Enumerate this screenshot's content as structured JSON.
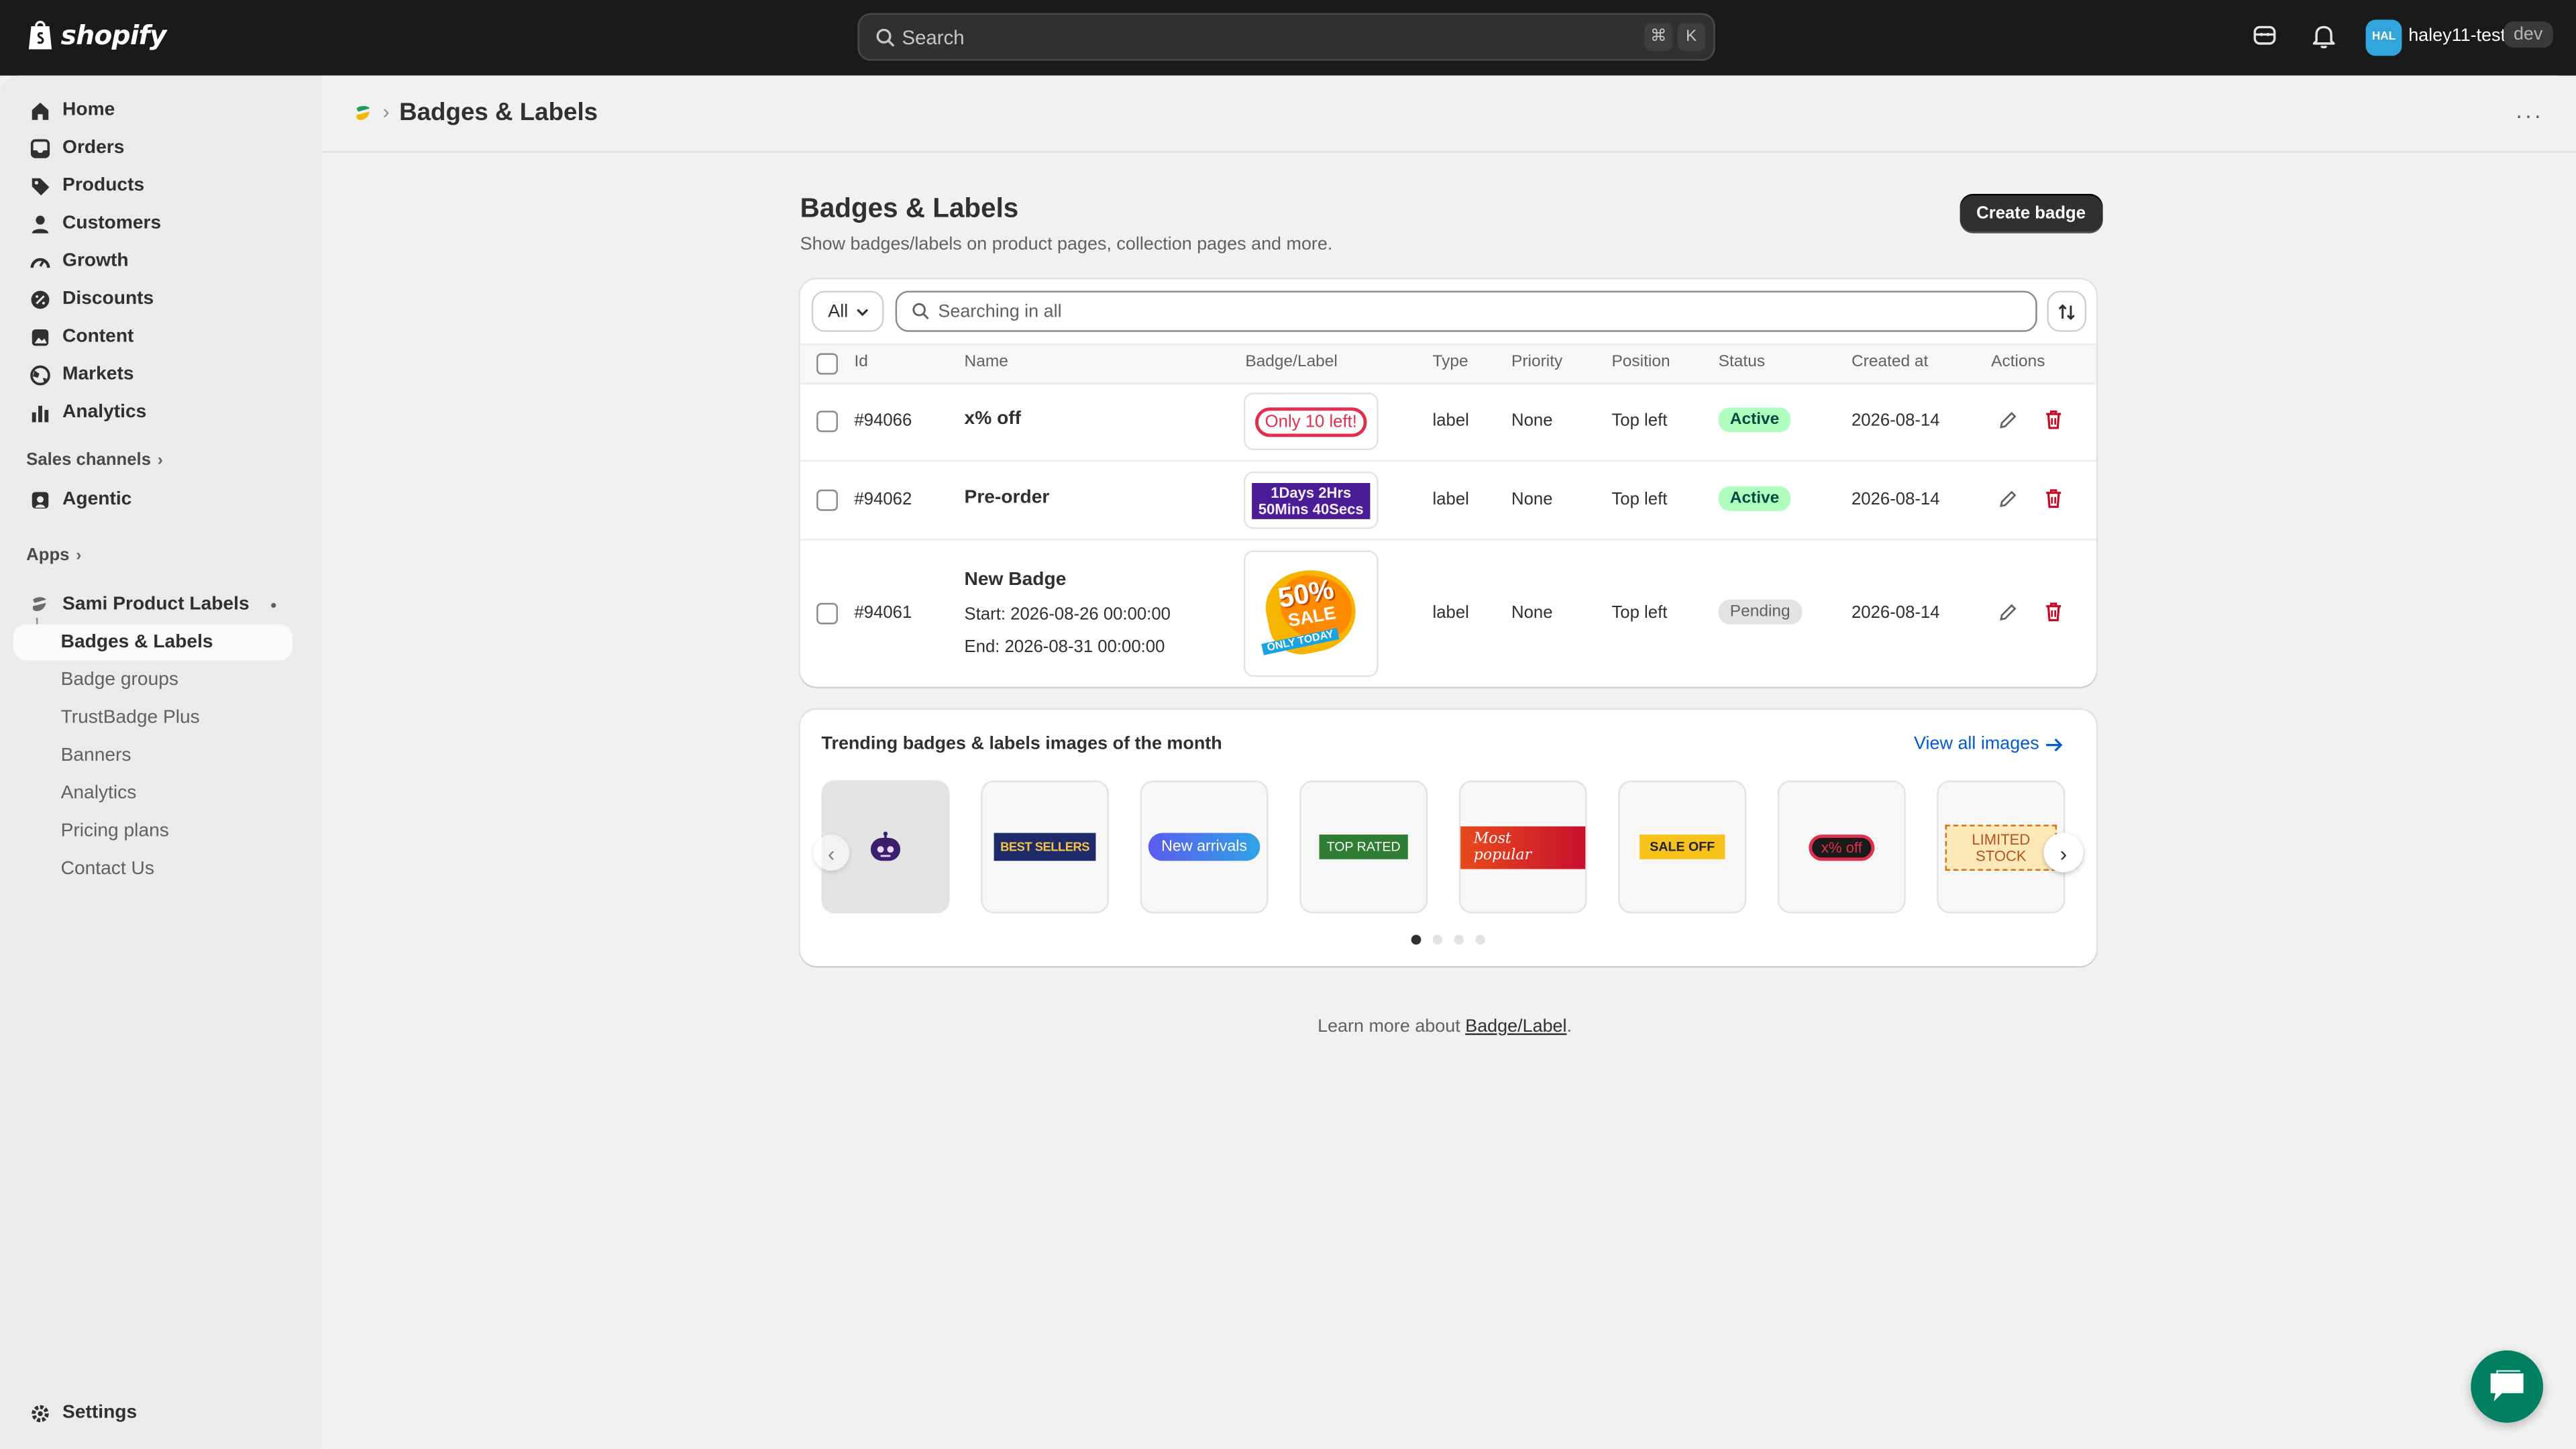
{
  "topbar": {
    "brand": "shopify",
    "search_placeholder": "Search",
    "shortcut_key1": "⌘",
    "shortcut_key2": "K",
    "avatar_initials": "HAL",
    "store_name": "haley11-test",
    "env_badge": "dev"
  },
  "sidebar": {
    "main_items": [
      {
        "label": "Home",
        "icon": "home-icon"
      },
      {
        "label": "Orders",
        "icon": "inbox-icon"
      },
      {
        "label": "Products",
        "icon": "tag-icon"
      },
      {
        "label": "Customers",
        "icon": "person-icon"
      },
      {
        "label": "Growth",
        "icon": "gauge-icon"
      },
      {
        "label": "Discounts",
        "icon": "discount-icon"
      },
      {
        "label": "Content",
        "icon": "content-icon"
      },
      {
        "label": "Markets",
        "icon": "globe-icon"
      },
      {
        "label": "Analytics",
        "icon": "bar-chart-icon"
      }
    ],
    "sales_channels_label": "Sales channels",
    "agentic_label": "Agentic",
    "apps_label": "Apps",
    "app_name": "Sami Product Labels",
    "app_subitems": [
      "Badges & Labels",
      "Badge groups",
      "TrustBadge Plus",
      "Banners",
      "Analytics",
      "Pricing plans",
      "Contact Us"
    ],
    "settings_label": "Settings"
  },
  "header": {
    "breadcrumb_title": "Badges & Labels"
  },
  "page": {
    "title": "Badges & Labels",
    "subtitle": "Show badges/labels on product pages, collection pages and more.",
    "create_button": "Create badge",
    "filter_value": "All",
    "search_placeholder": "Searching in all"
  },
  "table": {
    "columns": [
      "Id",
      "Name",
      "Badge/Label",
      "Type",
      "Priority",
      "Position",
      "Status",
      "Created at",
      "Actions"
    ],
    "rows": [
      {
        "id": "#94066",
        "name": "x% off",
        "badge_text": "Only 10 left!",
        "type": "label",
        "priority": "None",
        "position": "Top left",
        "status": "Active",
        "created": "2026-08-14"
      },
      {
        "id": "#94062",
        "name": "Pre-order",
        "badge_text": "1Days 2Hrs 50Mins 40Secs",
        "type": "label",
        "priority": "None",
        "position": "Top left",
        "status": "Active",
        "created": "2026-08-14"
      },
      {
        "id": "#94061",
        "name": "New Badge",
        "start": "Start: 2026-08-26 00:00:00",
        "end": "End: 2026-08-31 00:00:00",
        "badge_line1": "50%",
        "badge_line2": "SALE",
        "badge_line3": "ONLY TODAY",
        "type": "label",
        "priority": "None",
        "position": "Top left",
        "status": "Pending",
        "created": "2026-08-14"
      }
    ]
  },
  "trending": {
    "title": "Trending badges & labels images of the month",
    "view_all": "View all images",
    "tiles": [
      "BEST SELLERS",
      "New arrivals",
      "TOP RATED",
      "Most popular",
      "SALE OFF",
      "x% off",
      "LIMITED STOCK"
    ],
    "page_count": 4,
    "active_page": 1
  },
  "footer": {
    "learn_prefix": "Learn more about ",
    "learn_link": "Badge/Label",
    "learn_suffix": "."
  },
  "colors": {
    "topbar": "#1a1a1a",
    "active_badge": "#affebf",
    "delete_icon": "#c70a24",
    "link": "#005bd3",
    "chat": "#008060"
  }
}
